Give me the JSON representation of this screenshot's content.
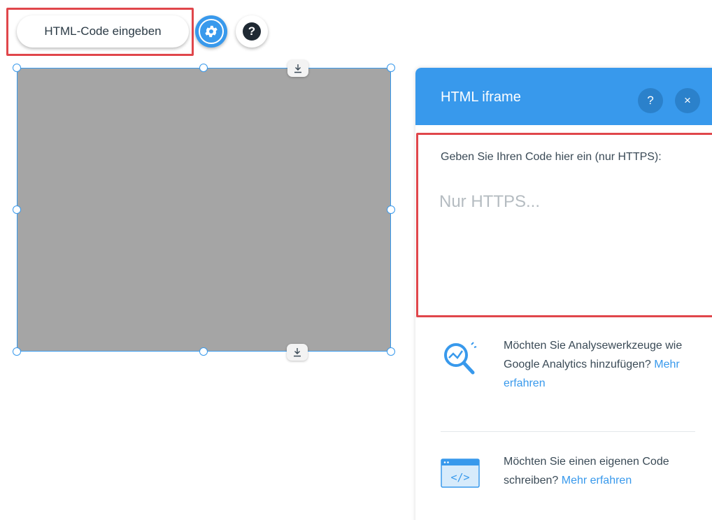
{
  "toolbar": {
    "enter_code_label": "HTML-Code eingeben",
    "settings_icon": "gear-icon",
    "help_icon": "question-icon",
    "help_glyph": "?"
  },
  "panel": {
    "title": "HTML iframe",
    "help_glyph": "?",
    "close_glyph": "×",
    "code_label": "Geben Sie Ihren Code hier ein (nur HTTPS):",
    "code_value": "",
    "code_placeholder": "Nur HTTPS...",
    "analytics": {
      "text": "Möchten Sie Analysewerkzeuge wie Google Analytics hinzufügen?",
      "link": "Mehr erfahren"
    },
    "custom_code": {
      "text": "Möchten Sie einen eigenen Code schreiben?",
      "link": "Mehr erfahren"
    }
  },
  "colors": {
    "accent": "#3899ec",
    "highlight": "#e0464b",
    "placeholder_fill": "#a5a5a5"
  }
}
